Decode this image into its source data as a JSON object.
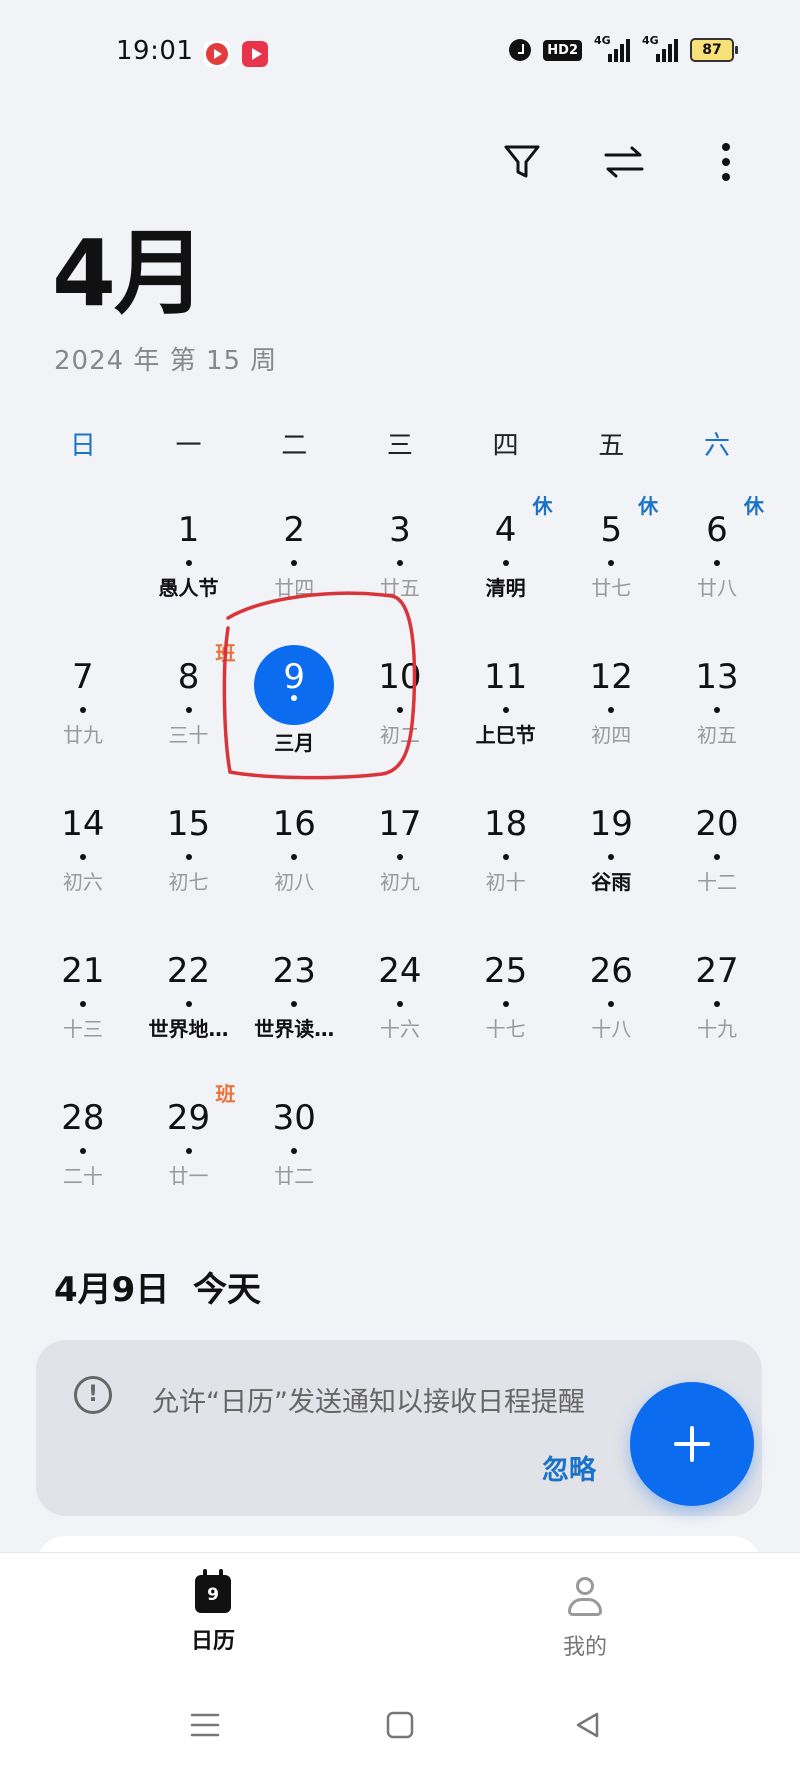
{
  "status_bar": {
    "time": "19:01",
    "hd_label": "HD2",
    "signal1_label": "4G",
    "signal2_label": "4G",
    "battery": "87"
  },
  "header": {
    "month": "4月",
    "year_week": "2024 年 第 15 周"
  },
  "weekdays": [
    "日",
    "一",
    "二",
    "三",
    "四",
    "五",
    "六"
  ],
  "weeks": [
    [
      {
        "day": "",
        "sub": ""
      },
      {
        "day": "1",
        "sub": "愚人节",
        "highlight": true
      },
      {
        "day": "2",
        "sub": "廿四"
      },
      {
        "day": "3",
        "sub": "廿五"
      },
      {
        "day": "4",
        "sub": "清明",
        "highlight": true,
        "badge": "休"
      },
      {
        "day": "5",
        "sub": "廿七",
        "badge": "休"
      },
      {
        "day": "6",
        "sub": "廿八",
        "badge": "休"
      }
    ],
    [
      {
        "day": "7",
        "sub": "廿九"
      },
      {
        "day": "8",
        "sub": "三十",
        "badge": "班"
      },
      {
        "day": "9",
        "sub": "三月",
        "today": true
      },
      {
        "day": "10",
        "sub": "初二"
      },
      {
        "day": "11",
        "sub": "上巳节",
        "highlight": true
      },
      {
        "day": "12",
        "sub": "初四"
      },
      {
        "day": "13",
        "sub": "初五"
      }
    ],
    [
      {
        "day": "14",
        "sub": "初六"
      },
      {
        "day": "15",
        "sub": "初七"
      },
      {
        "day": "16",
        "sub": "初八"
      },
      {
        "day": "17",
        "sub": "初九"
      },
      {
        "day": "18",
        "sub": "初十"
      },
      {
        "day": "19",
        "sub": "谷雨",
        "highlight": true
      },
      {
        "day": "20",
        "sub": "十二"
      }
    ],
    [
      {
        "day": "21",
        "sub": "十三"
      },
      {
        "day": "22",
        "sub": "世界地…",
        "highlight": true
      },
      {
        "day": "23",
        "sub": "世界读…",
        "highlight": true
      },
      {
        "day": "24",
        "sub": "十六"
      },
      {
        "day": "25",
        "sub": "十七"
      },
      {
        "day": "26",
        "sub": "十八"
      },
      {
        "day": "27",
        "sub": "十九"
      }
    ],
    [
      {
        "day": "28",
        "sub": "二十"
      },
      {
        "day": "29",
        "sub": "廿一",
        "badge": "班"
      },
      {
        "day": "30",
        "sub": "廿二"
      },
      {
        "day": "",
        "sub": ""
      },
      {
        "day": "",
        "sub": ""
      },
      {
        "day": "",
        "sub": ""
      },
      {
        "day": "",
        "sub": ""
      }
    ]
  ],
  "selected_date": {
    "date": "4月9日",
    "label": "今天"
  },
  "notice": {
    "text": "允许“日历”发送通知以接收日程提醒",
    "dismiss": "忽略"
  },
  "bottom_nav": {
    "calendar_icon_day": "9",
    "calendar_label": "日历",
    "me_label": "我的"
  },
  "colors": {
    "accent": "#0c6cf0",
    "weekend": "#1a73c9",
    "workday_badge": "#e8743b",
    "annotation": "#d9343a"
  }
}
